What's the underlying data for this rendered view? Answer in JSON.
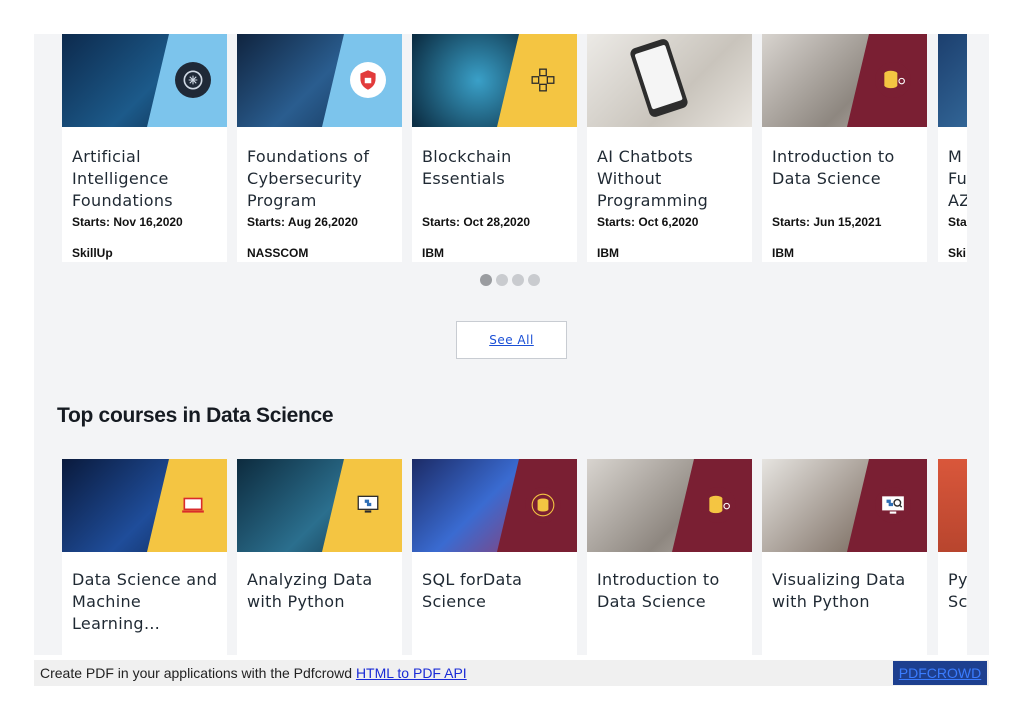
{
  "courses_row": {
    "cards": [
      {
        "title": "Artificial Intelligence Foundations",
        "start": "Starts: Nov 16,2020",
        "provider": "SkillUp",
        "accent": "#7cc4ec",
        "badge": "#1f2937",
        "icon": "ai-brain-icon"
      },
      {
        "title": "Foundations of Cybersecurity Program",
        "start": "Starts: Aug 26,2020",
        "provider": "NASSCOM",
        "accent": "#7cc4ec",
        "badge": "#ffffff",
        "icon": "security-shield-icon"
      },
      {
        "title": "Blockchain Essentials",
        "start": "Starts: Oct 28,2020",
        "provider": "IBM",
        "accent": "#f4c542",
        "badge": "#f4c542",
        "icon": "blockchain-cubes-icon"
      },
      {
        "title": "AI Chatbots Without Programming",
        "start": "Starts: Oct 6,2020",
        "provider": "IBM",
        "accent": "#ffffff",
        "badge": "#ffffff",
        "icon": "chatbot-phone-icon"
      },
      {
        "title": "Introduction to Data Science",
        "start": "Starts: Jun 15,2021",
        "provider": "IBM",
        "accent": "#7a1f33",
        "badge": "#7a1f33",
        "icon": "database-icon"
      },
      {
        "title": "M Fu AZ",
        "start": "Sta",
        "provider": "Ski",
        "accent": "#7cc4ec",
        "badge": "#7cc4ec",
        "icon": "partial-card-icon"
      }
    ]
  },
  "carousel": {
    "dots": 4,
    "active": 0
  },
  "see_all": "See All",
  "section_title": "Top courses in Data Science",
  "ds_row": {
    "cards": [
      {
        "title": "Data Science and Machine Learning…",
        "accent": "#f4c542",
        "icon": "laptop-icon"
      },
      {
        "title": "Analyzing Data with Python",
        "accent": "#f4c542",
        "icon": "python-monitor-icon"
      },
      {
        "title": "SQL forData Science",
        "accent": "#7a1f33",
        "icon": "sql-database-icon"
      },
      {
        "title": "Introduction to Data Science",
        "accent": "#7a1f33",
        "icon": "database-icon"
      },
      {
        "title": "Visualizing Data with Python",
        "accent": "#7a1f33",
        "icon": "python-search-icon"
      },
      {
        "title": "Py Sc",
        "accent": "#d9573b",
        "icon": "partial-card-icon"
      }
    ]
  },
  "footer": {
    "text": "Create PDF in your applications with the Pdfcrowd",
    "link": "HTML to PDF API",
    "button": "PDFCROWD"
  }
}
